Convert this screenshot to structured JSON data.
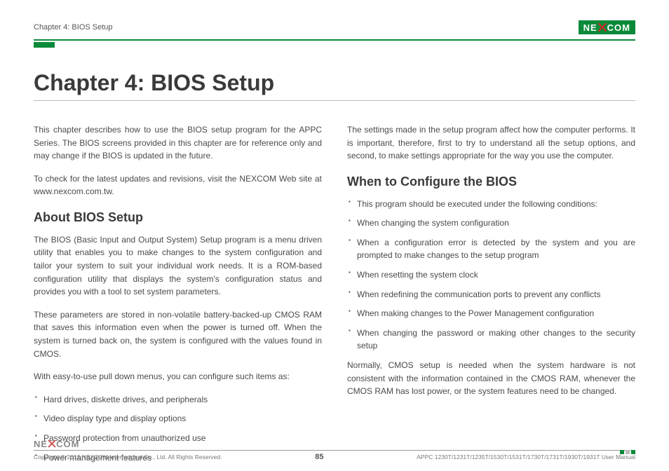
{
  "header": {
    "chapter_small": "Chapter 4: BIOS Setup",
    "logo_left": "NE",
    "logo_right": "COM"
  },
  "title": "Chapter 4: BIOS Setup",
  "left_col": {
    "intro1": "This chapter describes how to use the BIOS setup program for the APPC Series. The BIOS screens provided in this chapter are for reference only and may change if the BIOS is updated in the future.",
    "intro2": "To check for the latest updates and revisions, visit the NEXCOM Web site at www.nexcom.com.tw.",
    "h2": "About BIOS Setup",
    "p1": "The BIOS (Basic Input and Output System) Setup program is a menu driven utility that enables you to make changes to the system configuration and tailor your system to suit your individual work needs. It is a ROM-based configuration utility that displays the system's configuration status and provides you with a tool to set system parameters.",
    "p2": "These parameters are stored in non-volatile battery-backed-up CMOS RAM that saves this information even when the power is turned off. When the system is turned back on, the system is configured with the values found in CMOS.",
    "p3": "With easy-to-use pull down menus, you can configure such items as:",
    "items": [
      "Hard drives, diskette drives, and peripherals",
      "Video display type and display options",
      "Password protection from unauthorized use",
      "Power management features"
    ]
  },
  "right_col": {
    "top": "The settings made in the setup program affect how the computer performs. It is important, therefore, first to try to understand all the setup options, and second, to make settings appropriate for the way you use the computer.",
    "h2": "When to Configure the BIOS",
    "items": [
      "This program should be executed under the following conditions:",
      "When changing the system configuration",
      "When a configuration error is detected by the system and you are prompted to make changes to the setup program",
      "When resetting the system clock",
      "When redefining the communication ports to prevent any conflicts",
      "When making changes to the Power Management configuration",
      "When changing the password or making other changes to the security setup"
    ],
    "closing": "Normally, CMOS setup is needed when the system hardware is not consistent with the information contained in the CMOS RAM, whenever the CMOS RAM has lost power, or the system features need to be changed."
  },
  "footer": {
    "logo_left": "NE",
    "logo_right": "COM",
    "copyright": "Copyright © 2012 NEXCOM International Co., Ltd. All Rights Reserved.",
    "page": "85",
    "manual": "APPC 1230T/1231T/1235T/1530T/1531T/1730T/1731T/1930T/1931T User Manual"
  }
}
